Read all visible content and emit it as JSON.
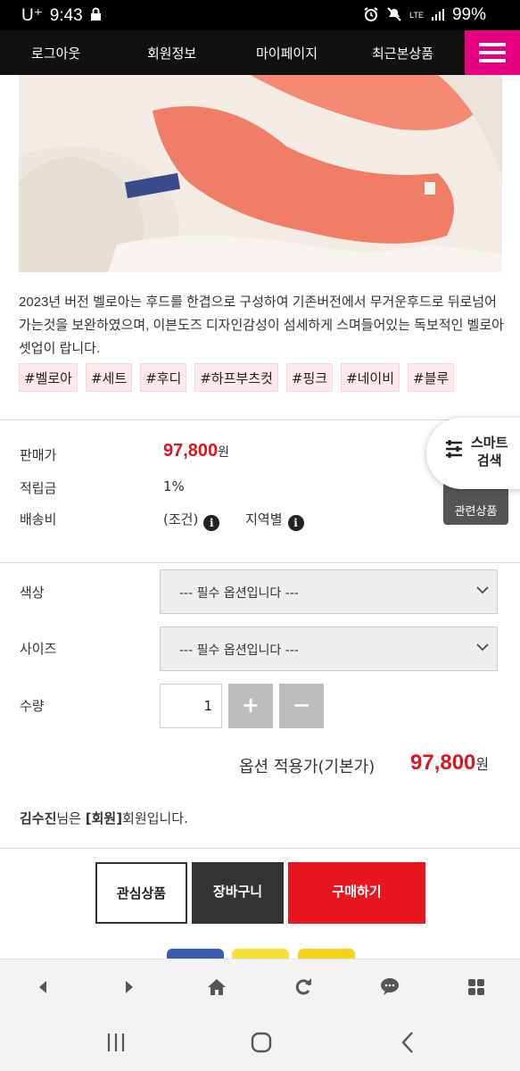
{
  "status_bar": {
    "carrier": "U⁺",
    "time": "9:43",
    "network": "LTE",
    "battery": "99%",
    "icons": [
      "lock-icon",
      "alarm-icon",
      "mute-icon",
      "signal-icon",
      "battery-icon"
    ]
  },
  "top_nav": {
    "items": [
      "로그아웃",
      "회원정보",
      "마이페이지",
      "최근본상품"
    ],
    "menu_icon": "hamburger-icon",
    "menu_color": "#e5007f"
  },
  "product": {
    "description": "2023년 버전 벨로아는 후드를 한겹으로 구성하여 기존버전에서 무거운후드로 뒤로넘어가는것을 보완하였으며, 이븐도즈 디자인감성이 섬세하게 스며들어있는 독보적인 벨로아 셋업이 랍니다.",
    "tags": [
      "#벨로아",
      "#세트",
      "#후디",
      "#하프부츠컷",
      "#핑크",
      "#네이비",
      "#블루"
    ]
  },
  "info": {
    "price_label": "판매가",
    "price": "97,800",
    "price_unit": "원",
    "points_label": "적립금",
    "points": "1%",
    "shipping_label": "배송비",
    "shipping_condition": "(조건)",
    "shipping_region": "지역별"
  },
  "floating": {
    "smart_search": "스마트\n검색",
    "related": "관련상품"
  },
  "options": {
    "color_label": "색상",
    "color_placeholder": "--- 필수 옵션입니다 ---",
    "size_label": "사이즈",
    "size_placeholder": "--- 필수 옵션입니다 ---",
    "qty_label": "수량",
    "qty_value": "1",
    "plus": "+",
    "minus": "−"
  },
  "total": {
    "label": "옵션 적용가(기본가)",
    "price": "97,800",
    "unit": "원"
  },
  "member": {
    "name": "김수진",
    "suffix1": "님은 ",
    "grade": "[회원]",
    "suffix2": "회원입니다."
  },
  "actions": {
    "wish": "관심상품",
    "cart": "장바구니",
    "buy": "구매하기",
    "buy_color": "#e8161f"
  },
  "browser_toolbar": {
    "icons": [
      "back-icon",
      "forward-icon",
      "home-icon",
      "refresh-icon",
      "chat-icon",
      "apps-icon"
    ]
  },
  "system_nav": {
    "icons": [
      "recents-icon",
      "home-circle-icon",
      "back-chevron-icon"
    ]
  }
}
